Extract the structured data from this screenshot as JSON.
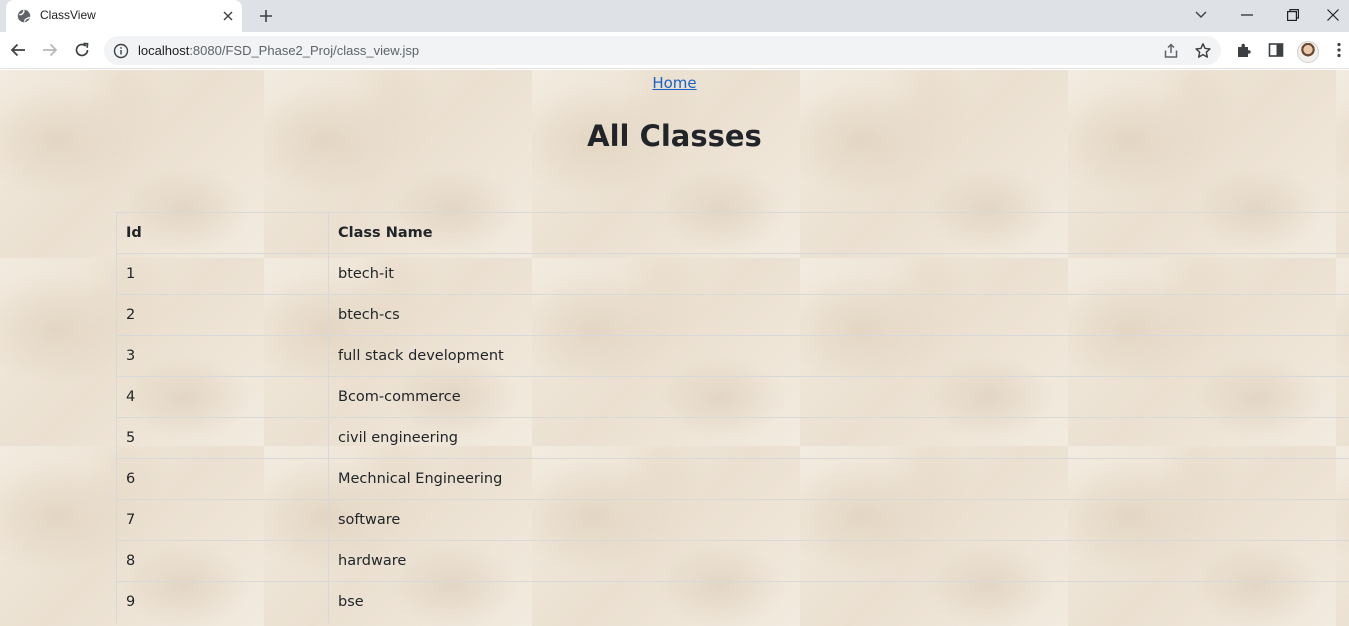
{
  "browser": {
    "tab_title": "ClassView",
    "url_host": "localhost",
    "url_path": ":8080/FSD_Phase2_Proj/class_view.jsp"
  },
  "page": {
    "home_link": "Home",
    "title": "All Classes",
    "table": {
      "headers": [
        "Id",
        "Class Name"
      ],
      "rows": [
        [
          "1",
          "btech-it"
        ],
        [
          "2",
          "btech-cs"
        ],
        [
          "3",
          "full stack development"
        ],
        [
          "4",
          "Bcom-commerce"
        ],
        [
          "5",
          "civil engineering"
        ],
        [
          "6",
          "Mechnical Engineering"
        ],
        [
          "7",
          "software"
        ],
        [
          "8",
          "hardware"
        ],
        [
          "9",
          "bse"
        ]
      ]
    }
  }
}
